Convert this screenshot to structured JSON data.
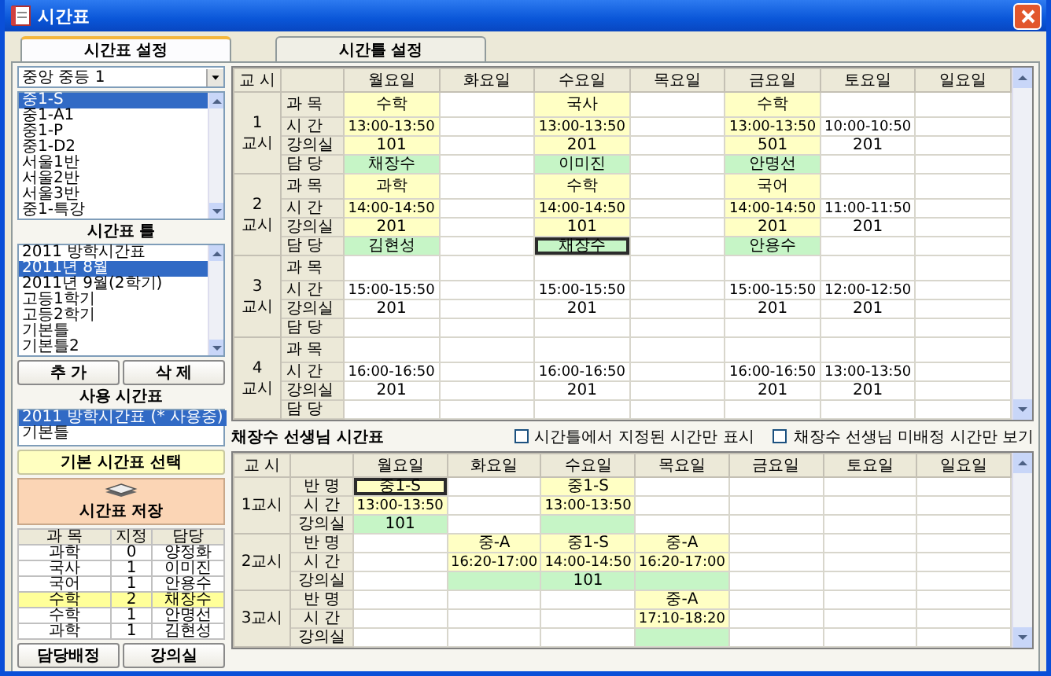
{
  "window": {
    "title": "시간표"
  },
  "tabs": [
    {
      "label": "시간표 설정",
      "selected": true
    },
    {
      "label": "시간틀 설정",
      "selected": false
    }
  ],
  "sidebar": {
    "school_select": {
      "value": "중앙 중등 1"
    },
    "classes": [
      {
        "label": "중1-S",
        "selected": true
      },
      {
        "label": "중1-A1",
        "selected": false
      },
      {
        "label": "중1-P",
        "selected": false
      },
      {
        "label": "중1-D2",
        "selected": false
      },
      {
        "label": "서울1반",
        "selected": false
      },
      {
        "label": "서울2반",
        "selected": false
      },
      {
        "label": "서울3반",
        "selected": false
      },
      {
        "label": "중1-특강",
        "selected": false
      }
    ],
    "frames_heading": "시간표 틀",
    "frames": [
      {
        "label": "2011 방학시간표",
        "selected": false
      },
      {
        "label": "2011년 8월",
        "selected": true
      },
      {
        "label": "2011년 9월(2학기)",
        "selected": false
      },
      {
        "label": "고등1학기",
        "selected": false
      },
      {
        "label": "고등2학기",
        "selected": false
      },
      {
        "label": "기본틀",
        "selected": false
      },
      {
        "label": "기본틀2",
        "selected": false
      }
    ],
    "frame_buttons": [
      "추 가",
      "삭 제"
    ],
    "active_heading": "사용 시간표",
    "active_frames": [
      {
        "label": "2011 방학시간표 (* 사용중)",
        "selected": true
      },
      {
        "label": "기본틀",
        "selected": false
      }
    ],
    "default_button": "기본 시간표 선택",
    "save_button": "시간표 저장",
    "subjects": {
      "columns": [
        "과 목",
        "지정",
        "담당"
      ],
      "rows": [
        {
          "cells": [
            "과학",
            "0",
            "양정화"
          ],
          "selected": false
        },
        {
          "cells": [
            "국사",
            "1",
            "이미진"
          ],
          "selected": false
        },
        {
          "cells": [
            "국어",
            "1",
            "안용수"
          ],
          "selected": false
        },
        {
          "cells": [
            "수학",
            "2",
            "채장수"
          ],
          "selected": true
        },
        {
          "cells": [
            "수학",
            "1",
            "안명선"
          ],
          "selected": false
        },
        {
          "cells": [
            "과학",
            "1",
            "김현성"
          ],
          "selected": false
        }
      ]
    },
    "bottom_buttons": [
      "담당배정",
      "강의실"
    ]
  },
  "class_timetable": {
    "period_heading": "교 시",
    "days": [
      "월요일",
      "화요일",
      "수요일",
      "목요일",
      "금요일",
      "토요일",
      "일요일"
    ],
    "periods": [
      {
        "number": "1",
        "unit": "교시",
        "fields": [
          "과 목",
          "시 간",
          "강의실",
          "담 당"
        ],
        "days": [
          {
            "subject": "수학",
            "time": "13:00-13:50",
            "room": "101",
            "teacher": "채장수",
            "assigned": true,
            "selected": false
          },
          {
            "assigned": false,
            "selected": false
          },
          {
            "subject": "국사",
            "time": "13:00-13:50",
            "room": "201",
            "teacher": "이미진",
            "assigned": true,
            "selected": false
          },
          {
            "assigned": false,
            "selected": false
          },
          {
            "subject": "수학",
            "time": "13:00-13:50",
            "room": "501",
            "teacher": "안명선",
            "assigned": true,
            "selected": false
          },
          {
            "time": "10:00-10:50",
            "room": "201",
            "assigned": false,
            "selected": false
          },
          {
            "assigned": false,
            "selected": false
          }
        ]
      },
      {
        "number": "2",
        "unit": "교시",
        "fields": [
          "과 목",
          "시 간",
          "강의실",
          "담 당"
        ],
        "days": [
          {
            "subject": "과학",
            "time": "14:00-14:50",
            "room": "201",
            "teacher": "김현성",
            "assigned": true,
            "selected": false
          },
          {
            "assigned": false,
            "selected": false
          },
          {
            "subject": "수학",
            "time": "14:00-14:50",
            "room": "101",
            "teacher": "채장수",
            "assigned": true,
            "selected": true
          },
          {
            "assigned": false,
            "selected": false
          },
          {
            "subject": "국어",
            "time": "14:00-14:50",
            "room": "201",
            "teacher": "안용수",
            "assigned": true,
            "selected": false
          },
          {
            "time": "11:00-11:50",
            "room": "201",
            "assigned": false,
            "selected": false
          },
          {
            "assigned": false,
            "selected": false
          }
        ]
      },
      {
        "number": "3",
        "unit": "교시",
        "fields": [
          "과 목",
          "시 간",
          "강의실",
          "담 당"
        ],
        "days": [
          {
            "time": "15:00-15:50",
            "room": "201",
            "assigned": false,
            "selected": false
          },
          {
            "assigned": false,
            "selected": false
          },
          {
            "time": "15:00-15:50",
            "room": "201",
            "assigned": false,
            "selected": false
          },
          {
            "assigned": false,
            "selected": false
          },
          {
            "time": "15:00-15:50",
            "room": "201",
            "assigned": false,
            "selected": false
          },
          {
            "time": "12:00-12:50",
            "room": "201",
            "assigned": false,
            "selected": false
          },
          {
            "assigned": false,
            "selected": false
          }
        ]
      },
      {
        "number": "4",
        "unit": "교시",
        "fields": [
          "과 목",
          "시 간",
          "강의실",
          "담 당"
        ],
        "days": [
          {
            "time": "16:00-16:50",
            "room": "201",
            "assigned": false,
            "selected": false
          },
          {
            "assigned": false,
            "selected": false
          },
          {
            "time": "16:00-16:50",
            "room": "201",
            "assigned": false,
            "selected": false
          },
          {
            "assigned": false,
            "selected": false
          },
          {
            "time": "16:00-16:50",
            "room": "201",
            "assigned": false,
            "selected": false
          },
          {
            "time": "13:00-13:50",
            "room": "201",
            "assigned": false,
            "selected": false
          },
          {
            "assigned": false,
            "selected": false
          }
        ]
      }
    ]
  },
  "teacher_timetable": {
    "title": "채장수 선생님 시간표",
    "options": [
      {
        "label": "시간틀에서 지정된 시간만 표시",
        "checked": false
      },
      {
        "label": "채장수 선생님 미배정 시간만 보기",
        "checked": false
      }
    ],
    "period_heading": "교 시",
    "days": [
      "월요일",
      "화요일",
      "수요일",
      "목요일",
      "금요일",
      "토요일",
      "일요일"
    ],
    "periods": [
      {
        "label": "1교시",
        "fields": [
          "반 명",
          "시 간",
          "강의실"
        ],
        "days": [
          {
            "class": "중1-S",
            "time": "13:00-13:50",
            "room": "101",
            "assigned": true,
            "selected": true
          },
          {
            "assigned": false,
            "selected": false
          },
          {
            "class": "중1-S",
            "time": "13:00-13:50",
            "assigned": true,
            "selected": false
          },
          {
            "assigned": false,
            "selected": false
          },
          {
            "assigned": false,
            "selected": false
          },
          {
            "assigned": false,
            "selected": false
          },
          {
            "assigned": false,
            "selected": false
          }
        ]
      },
      {
        "label": "2교시",
        "fields": [
          "반 명",
          "시 간",
          "강의실"
        ],
        "days": [
          {
            "assigned": false,
            "selected": false
          },
          {
            "class": "중-A",
            "time": "16:20-17:00",
            "assigned": true,
            "selected": false
          },
          {
            "class": "중1-S",
            "time": "14:00-14:50",
            "room": "101",
            "assigned": true,
            "selected": false
          },
          {
            "class": "중-A",
            "time": "16:20-17:00",
            "assigned": true,
            "selected": false
          },
          {
            "assigned": false,
            "selected": false
          },
          {
            "assigned": false,
            "selected": false
          },
          {
            "assigned": false,
            "selected": false
          }
        ]
      },
      {
        "label": "3교시",
        "fields": [
          "반 명",
          "시 간",
          "강의실"
        ],
        "days": [
          {
            "assigned": false,
            "selected": false
          },
          {
            "assigned": false,
            "selected": false
          },
          {
            "assigned": false,
            "selected": false
          },
          {
            "class": "중-A",
            "time": "17:10-18:20",
            "assigned": true,
            "selected": false
          },
          {
            "assigned": false,
            "selected": false
          },
          {
            "assigned": false,
            "selected": false
          },
          {
            "assigned": false,
            "selected": false
          }
        ]
      }
    ]
  }
}
